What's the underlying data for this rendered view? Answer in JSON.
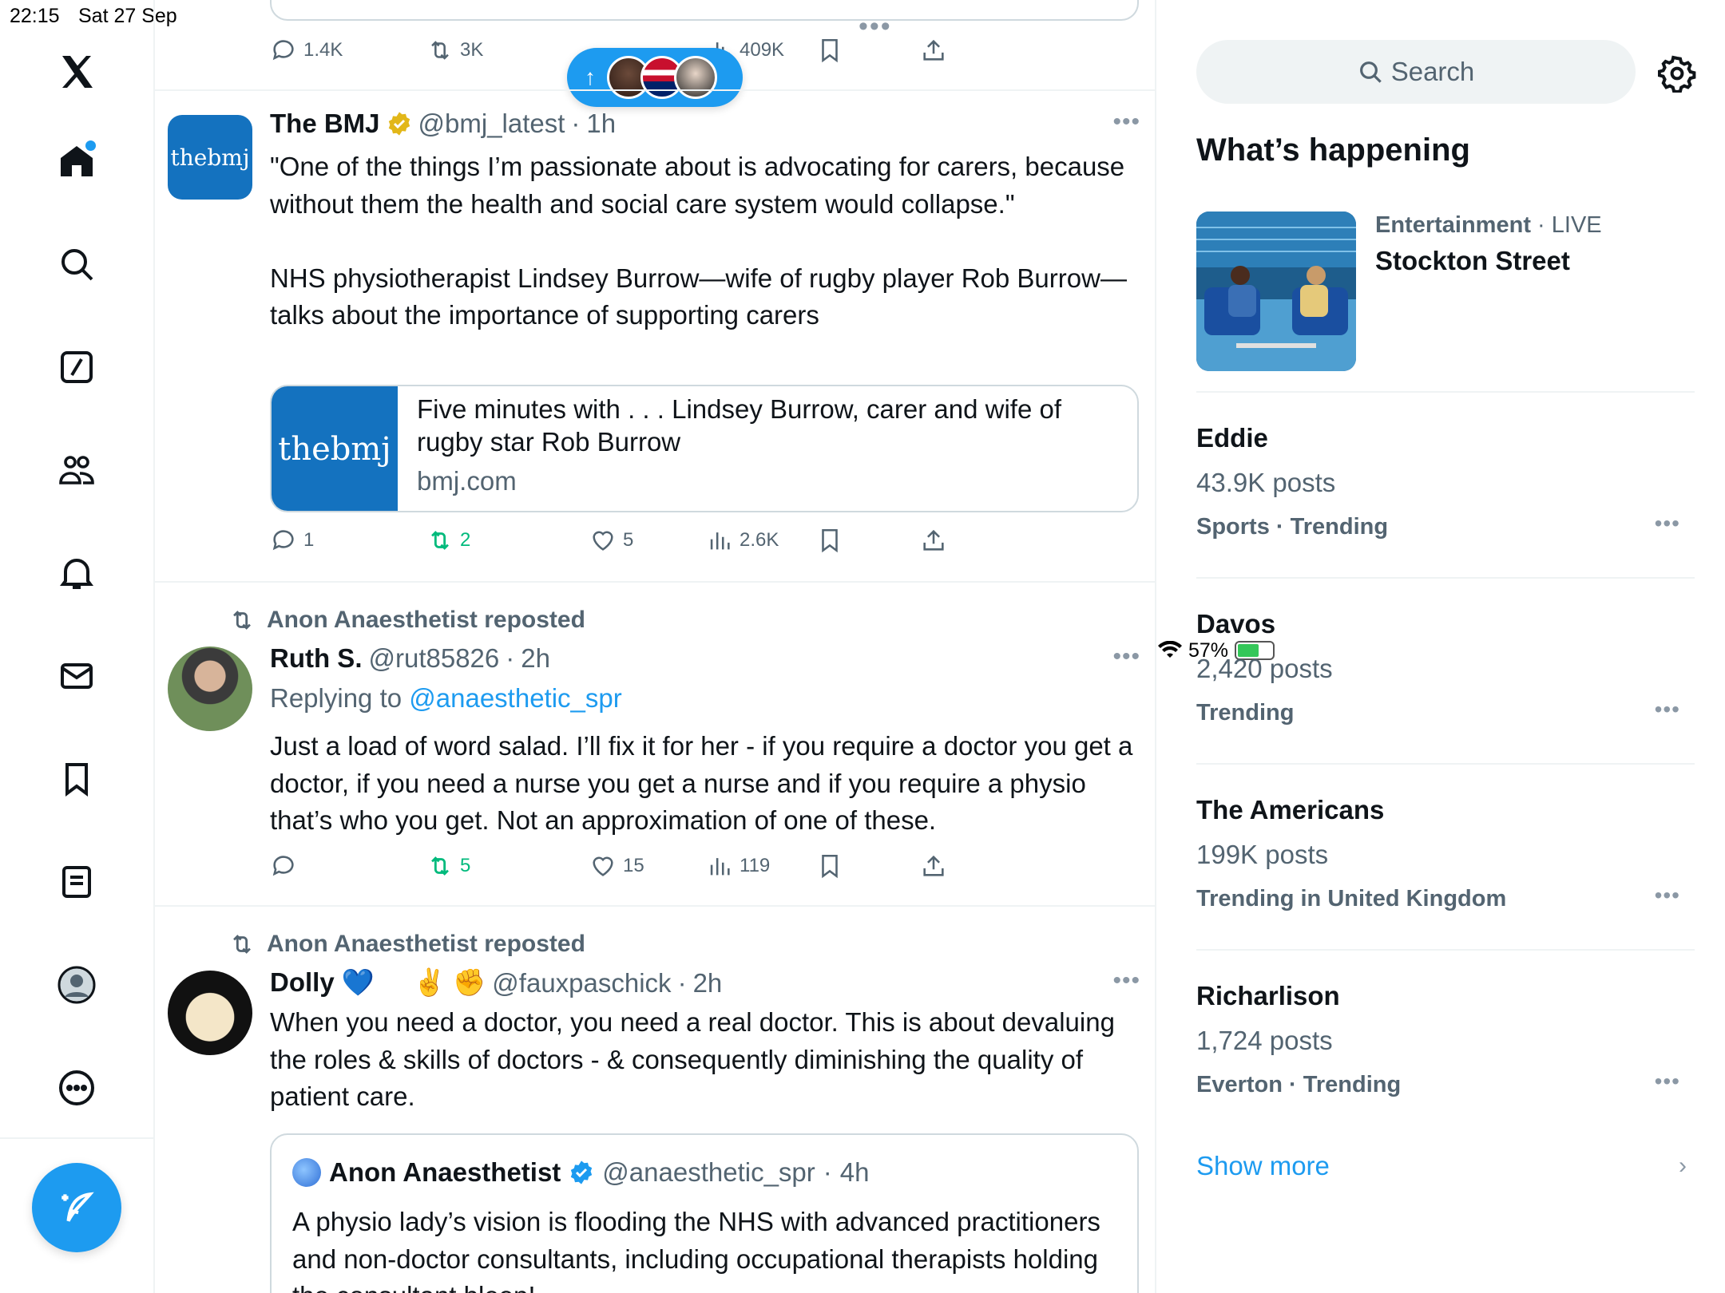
{
  "status": {
    "time": "22:15",
    "date": "Sat 27 Sep",
    "battery": "57%"
  },
  "feed": {
    "prev_post": {
      "replies": "1.4K",
      "reposts": "3K",
      "views": "409K"
    },
    "posts": [
      {
        "name": "The BMJ",
        "handle": "@bmj_latest",
        "time": "1h",
        "avatar_text": "thebmj",
        "text": "\"One of the things I’m passionate about is advocating for carers, because without them the health and social care system would collapse.\"\n\nNHS physiotherapist Lindsey Burrow—wife of rugby player Rob Burrow—talks about the importance of supporting carers",
        "card": {
          "thumb_text": "thebmj",
          "title": "Five minutes with . . . Lindsey Burrow, carer and wife of rugby star Rob Burrow",
          "domain": "bmj.com"
        },
        "stats": {
          "replies": "1",
          "reposts": "2",
          "likes": "5",
          "views": "2.6K"
        }
      },
      {
        "reposted_by": "Anon Anaesthetist reposted",
        "name": "Ruth S.",
        "handle": "@rut85826",
        "time": "2h",
        "replying_prefix": "Replying to ",
        "replying_to": "@anaesthetic_spr",
        "text": "Just a load of word salad. I’ll fix it for her - if you require a doctor you get a doctor, if you need a nurse you get a nurse and if you require a physio that’s who you get. Not an approximation of one of these.",
        "stats": {
          "reposts": "5",
          "likes": "15",
          "views": "119"
        }
      },
      {
        "reposted_by": "Anon Anaesthetist reposted",
        "name": "Dolly 💙",
        "name_emoji": "✌️ ✊",
        "handle": "@fauxpaschick",
        "time": "2h",
        "text": "When you need a doctor, you need a real doctor. This is about devaluing the roles & skills of doctors - & consequently diminishing the quality of patient care.",
        "quote": {
          "name": "Anon Anaesthetist",
          "handle": "@anaesthetic_spr",
          "time": "4h",
          "text": "A physio lady’s vision is flooding the NHS with advanced practitioners and non-doctor consultants, including occupational therapists holding the consultant bleep!"
        }
      }
    ]
  },
  "sidebar": {
    "search_placeholder": "Search",
    "heading": "What’s happening",
    "featured": {
      "category": "Entertainment",
      "live": "LIVE",
      "title": "Stockton Street"
    },
    "trends": [
      {
        "title": "Eddie",
        "posts": "43.9K posts",
        "context": "Sports · Trending"
      },
      {
        "title": "Davos",
        "posts": "2,420 posts",
        "context": "Trending"
      },
      {
        "title": "The Americans",
        "posts": "199K posts",
        "context": "Trending in United Kingdom"
      },
      {
        "title": "Richarlison",
        "posts": "1,724 posts",
        "context": "Everton · Trending"
      }
    ],
    "show_more": "Show more"
  },
  "colors": {
    "accent": "#1d9bf0",
    "repost_green": "#00ba7c",
    "muted": "#536471",
    "bmj_blue": "#1472bf"
  },
  "icons": [
    "x-logo-icon",
    "home-icon",
    "search-icon",
    "grok-icon",
    "communities-icon",
    "bell-icon",
    "mail-icon",
    "bookmark-icon",
    "lists-icon",
    "profile-icon",
    "more-icon",
    "compose-icon",
    "reply-icon",
    "repost-icon",
    "like-icon",
    "views-icon",
    "share-icon",
    "verified-icon",
    "gear-icon",
    "chevron-right-icon"
  ]
}
